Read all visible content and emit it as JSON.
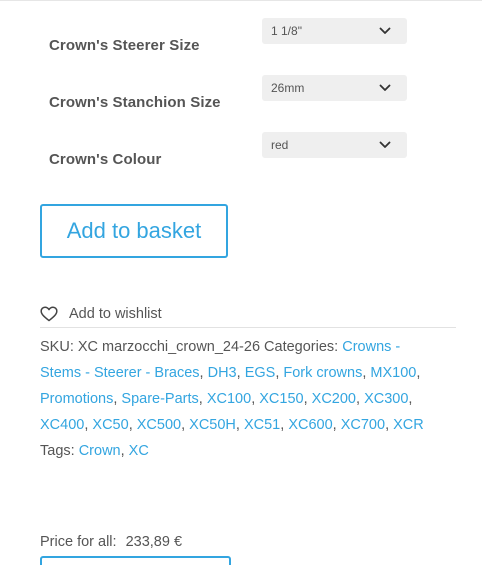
{
  "variations": [
    {
      "label": "Crown's Steerer Size",
      "value": "1 1/8\""
    },
    {
      "label": "Crown's Stanchion Size",
      "value": "26mm"
    },
    {
      "label": "Crown's Colour",
      "value": "red"
    }
  ],
  "actions": {
    "add_to_basket": "Add to basket",
    "add_to_wishlist": "Add to wishlist"
  },
  "meta": {
    "sku_label": "SKU:",
    "sku": "XC marzocchi_crown_24-26",
    "categories_label": "Categories:",
    "categories": [
      "Crowns - Stems - Steerer - Braces",
      "DH3",
      "EGS",
      "Fork crowns",
      "MX100",
      "Promotions",
      "Spare-Parts",
      "XC100",
      "XC150",
      "XC200",
      "XC300",
      "XC400",
      "XC50",
      "XC500",
      "XC50H",
      "XC51",
      "XC600",
      "XC700",
      "XCR"
    ],
    "tags_label": "Tags:",
    "tags": [
      "Crown",
      "XC"
    ]
  },
  "price": {
    "label": "Price for all:",
    "amount": "233,89 €"
  },
  "colors": {
    "accent": "#33a5e0",
    "text": "#555555",
    "select_bg": "#efefef"
  },
  "icons": {
    "wishlist": "heart-outline-icon",
    "select": "chevron-down-icon"
  }
}
